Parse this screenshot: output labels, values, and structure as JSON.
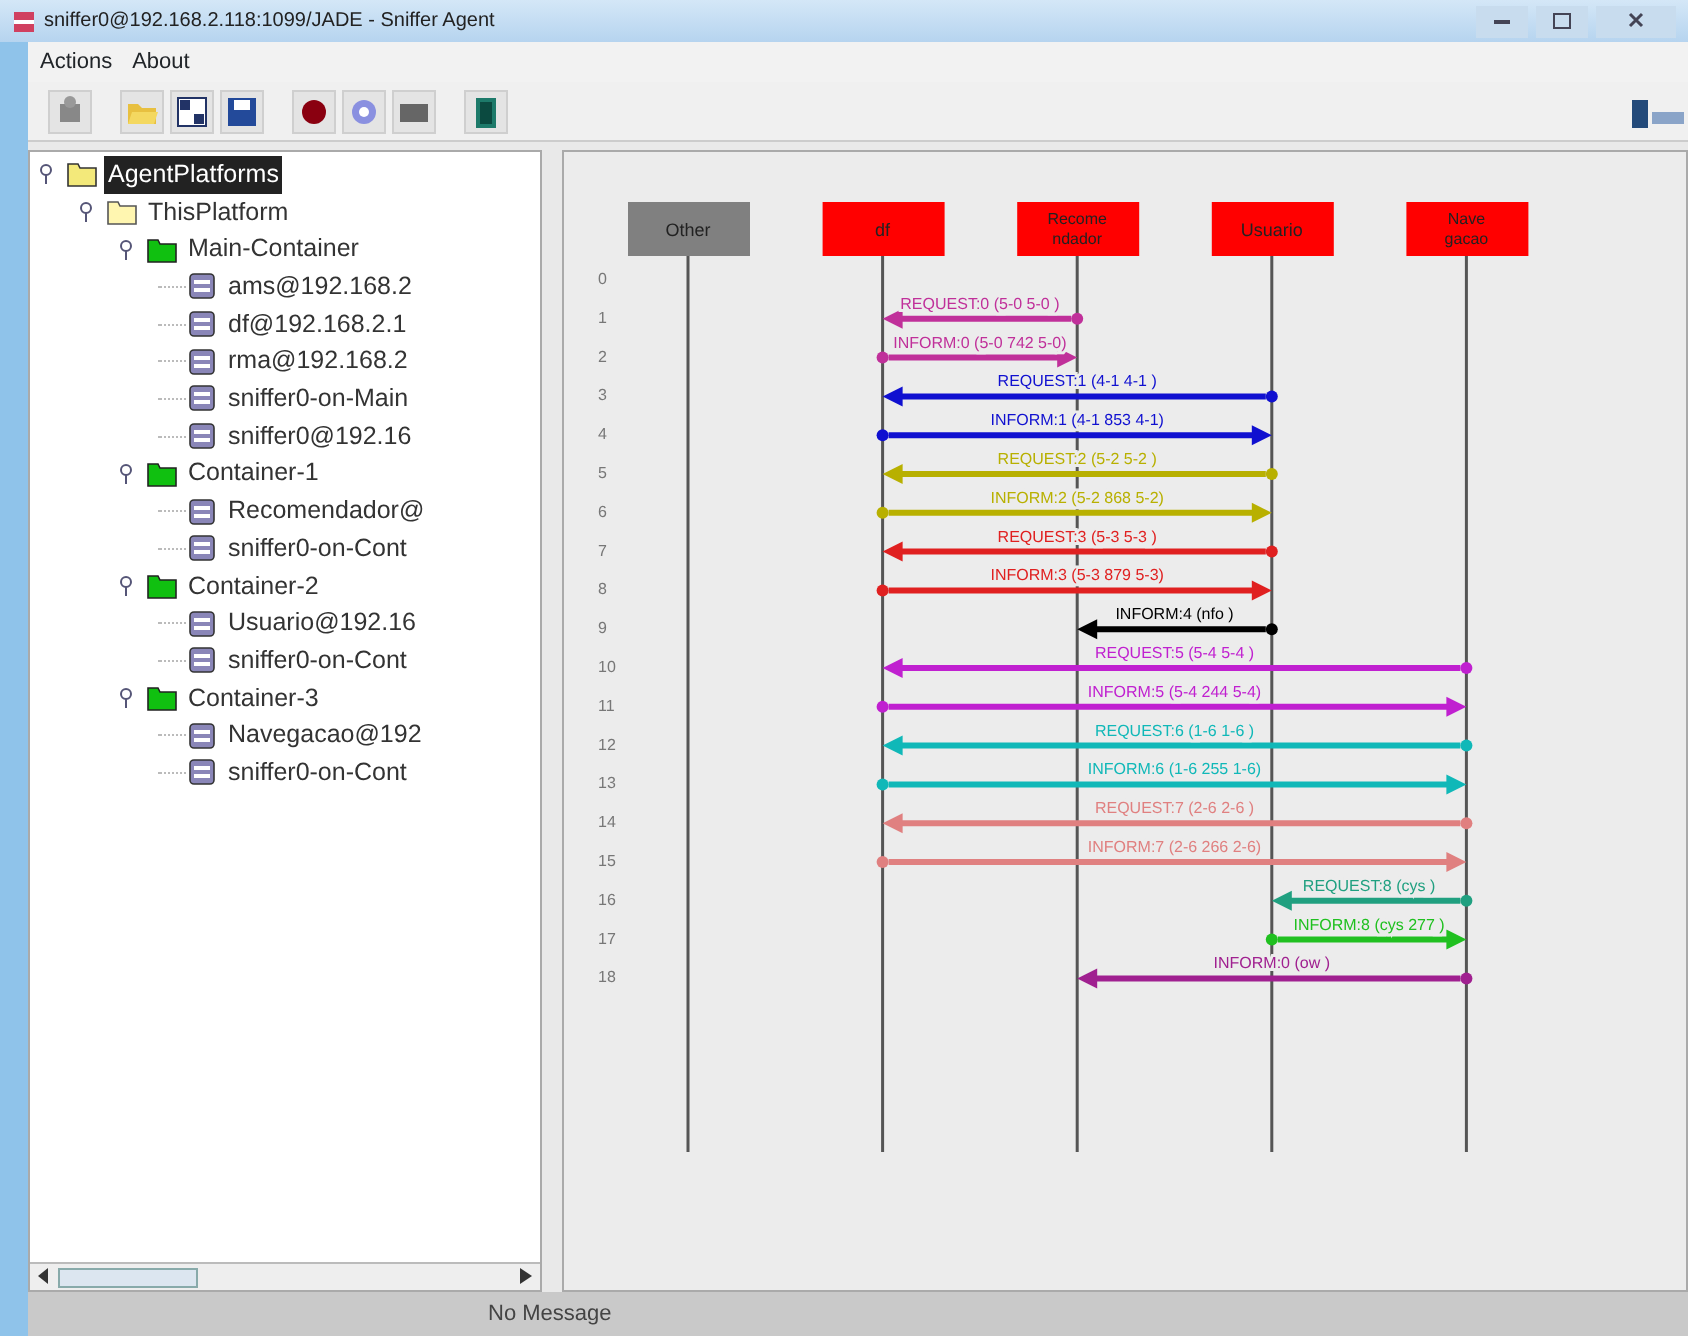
{
  "window": {
    "title": "sniffer0@192.168.2.118:1099/JADE - Sniffer Agent"
  },
  "menu": [
    "Actions",
    "About"
  ],
  "tree": [
    {
      "label": "AgentPlatforms",
      "kind": "platforms",
      "selected": true,
      "expanded": true,
      "children": [
        {
          "label": "ThisPlatform",
          "kind": "platform",
          "selected": false,
          "expanded": true,
          "children": [
            {
              "label": "Main-Container",
              "kind": "container",
              "selected": false,
              "expanded": true,
              "children": [
                {
                  "label": "ams@192.168.2",
                  "kind": "agent",
                  "selected": false
                },
                {
                  "label": "df@192.168.2.1",
                  "kind": "agent",
                  "selected": false
                },
                {
                  "label": "rma@192.168.2",
                  "kind": "agent",
                  "selected": false
                },
                {
                  "label": "sniffer0-on-Main",
                  "kind": "agent",
                  "selected": false
                },
                {
                  "label": "sniffer0@192.16",
                  "kind": "agent",
                  "selected": false
                }
              ]
            },
            {
              "label": "Container-1",
              "kind": "container",
              "selected": false,
              "expanded": true,
              "children": [
                {
                  "label": "Recomendador@",
                  "kind": "agent",
                  "selected": false
                },
                {
                  "label": "sniffer0-on-Cont",
                  "kind": "agent",
                  "selected": false
                }
              ]
            },
            {
              "label": "Container-2",
              "kind": "container",
              "selected": false,
              "expanded": true,
              "children": [
                {
                  "label": "Usuario@192.16",
                  "kind": "agent",
                  "selected": false
                },
                {
                  "label": "sniffer0-on-Cont",
                  "kind": "agent",
                  "selected": false
                }
              ]
            },
            {
              "label": "Container-3",
              "kind": "container",
              "selected": false,
              "expanded": true,
              "children": [
                {
                  "label": "Navegacao@192",
                  "kind": "agent",
                  "selected": false
                },
                {
                  "label": "sniffer0-on-Cont",
                  "kind": "agent",
                  "selected": false
                }
              ]
            }
          ]
        }
      ]
    }
  ],
  "agents": [
    {
      "lines": [
        "Other"
      ],
      "color": "#808080"
    },
    {
      "lines": [
        "df"
      ],
      "color": "#ff0000"
    },
    {
      "lines": [
        "Recome",
        "ndador"
      ],
      "color": "#ff0000"
    },
    {
      "lines": [
        "Usuario"
      ],
      "color": "#ff0000"
    },
    {
      "lines": [
        "Nave",
        "gacao"
      ],
      "color": "#ff0000"
    }
  ],
  "rows": [
    "0",
    "1",
    "2",
    "3",
    "4",
    "5",
    "6",
    "7",
    "8",
    "9",
    "10",
    "11",
    "12",
    "13",
    "14",
    "15",
    "16",
    "17",
    "18"
  ],
  "messages": [
    {
      "kind": "left",
      "lanes": [
        false,
        true,
        true,
        false,
        false
      ],
      "label": "REQUEST:0 (5-0 5-0 )",
      "color": "#c0309a"
    },
    {
      "kind": "right",
      "lanes": [
        false,
        true,
        true,
        false,
        false
      ],
      "label": "INFORM:0 (5-0 742 5-0)",
      "color": "#c0309a"
    },
    {
      "kind": "left",
      "lanes": [
        false,
        true,
        false,
        true,
        false
      ],
      "label": "REQUEST:1 (4-1 4-1 )",
      "color": "#1010d0"
    },
    {
      "kind": "right",
      "lanes": [
        false,
        true,
        false,
        true,
        false
      ],
      "label": "INFORM:1 (4-1 853 4-1)",
      "color": "#1010d0"
    },
    {
      "kind": "left",
      "lanes": [
        false,
        true,
        false,
        true,
        false
      ],
      "label": "REQUEST:2 (5-2 5-2 )",
      "color": "#b8b000"
    },
    {
      "kind": "right",
      "lanes": [
        false,
        true,
        false,
        true,
        false
      ],
      "label": "INFORM:2 (5-2 868 5-2)",
      "color": "#b8b000"
    },
    {
      "kind": "left",
      "lanes": [
        false,
        true,
        false,
        true,
        false
      ],
      "label": "REQUEST:3 (5-3 5-3 )",
      "color": "#e02020"
    },
    {
      "kind": "right",
      "lanes": [
        false,
        true,
        false,
        true,
        false
      ],
      "label": "INFORM:3 (5-3 879 5-3)",
      "color": "#e02020"
    },
    {
      "kind": "left",
      "lanes": [
        false,
        false,
        true,
        true,
        false
      ],
      "label": "INFORM:4 (nfo )",
      "color": "#000000"
    },
    {
      "kind": "left",
      "lanes": [
        false,
        true,
        false,
        false,
        true
      ],
      "label": "REQUEST:5 (5-4 5-4 )",
      "color": "#c020d0"
    },
    {
      "kind": "right",
      "lanes": [
        false,
        true,
        false,
        false,
        true
      ],
      "label": "INFORM:5 (5-4 244 5-4)",
      "color": "#c020d0"
    },
    {
      "kind": "left",
      "lanes": [
        false,
        true,
        false,
        false,
        true
      ],
      "label": "REQUEST:6 (1-6 1-6 )",
      "color": "#10b8b8"
    },
    {
      "kind": "right",
      "lanes": [
        false,
        true,
        false,
        false,
        true
      ],
      "label": "INFORM:6 (1-6 255 1-6)",
      "color": "#10b8b8"
    },
    {
      "kind": "left",
      "lanes": [
        false,
        true,
        false,
        false,
        true
      ],
      "label": "REQUEST:7 (2-6 2-6 )",
      "color": "#e08080"
    },
    {
      "kind": "right",
      "lanes": [
        false,
        true,
        false,
        false,
        true
      ],
      "label": "INFORM:7 (2-6 266 2-6)",
      "color": "#e08080"
    },
    {
      "kind": "left",
      "lanes": [
        false,
        false,
        false,
        true,
        true
      ],
      "label": "REQUEST:8 (cys )",
      "color": "#20a080"
    },
    {
      "kind": "right",
      "lanes": [
        false,
        false,
        false,
        true,
        true
      ],
      "label": "INFORM:8 (cys 277 )",
      "color": "#20c020"
    },
    {
      "kind": "left",
      "lanes": [
        false,
        false,
        true,
        false,
        true
      ],
      "label": "INFORM:0 (ow )",
      "color": "#a02090"
    }
  ],
  "status_bar": "No Message"
}
